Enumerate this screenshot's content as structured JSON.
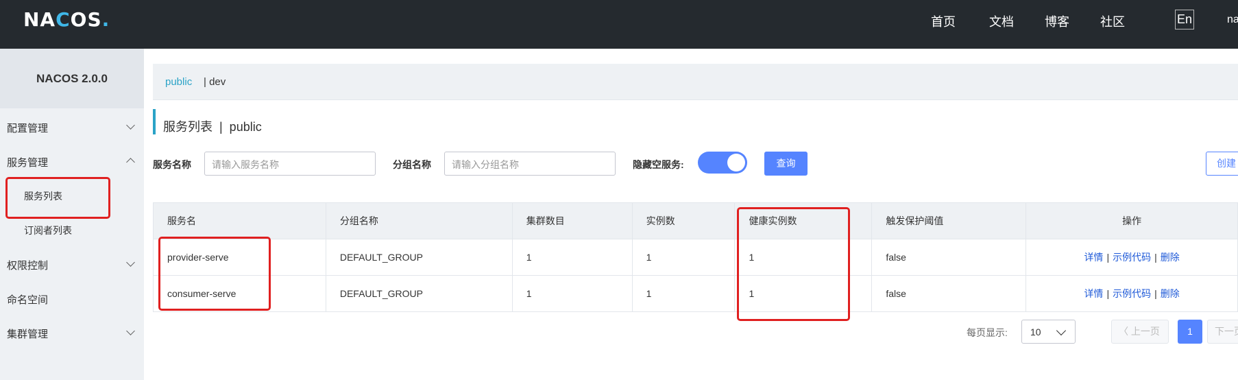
{
  "header": {
    "logo": "NACOS.",
    "nav": [
      "首页",
      "文档",
      "博客",
      "社区"
    ],
    "lang": "En",
    "user": "na"
  },
  "sidebar": {
    "version": "NACOS 2.0.0",
    "items": [
      {
        "label": "配置管理"
      },
      {
        "label": "服务管理"
      },
      {
        "label": "服务列表"
      },
      {
        "label": "订阅者列表"
      },
      {
        "label": "权限控制"
      },
      {
        "label": "命名空间"
      },
      {
        "label": "集群管理"
      }
    ]
  },
  "namespaces": {
    "active": "public",
    "other": "| dev"
  },
  "page": {
    "title": "服务列表  |  public"
  },
  "filters": {
    "service_label": "服务名称",
    "service_placeholder": "请输入服务名称",
    "group_label": "分组名称",
    "group_placeholder": "请输入分组名称",
    "hide_empty_label": "隐藏空服务:",
    "query_button": "查询",
    "create_button": "创建"
  },
  "table": {
    "headers": [
      "服务名",
      "分组名称",
      "集群数目",
      "实例数",
      "健康实例数",
      "触发保护阈值",
      "操作"
    ],
    "rows": [
      {
        "name": "provider-serve",
        "group": "DEFAULT_GROUP",
        "clusters": "1",
        "instances": "1",
        "healthy": "1",
        "threshold": "false"
      },
      {
        "name": "consumer-serve",
        "group": "DEFAULT_GROUP",
        "clusters": "1",
        "instances": "1",
        "healthy": "1",
        "threshold": "false"
      }
    ],
    "actions": {
      "detail": "详情",
      "sample": "示例代码",
      "delete": "删除"
    }
  },
  "pagination": {
    "per_page_label": "每页显示:",
    "per_page_value": "10",
    "prev": "〈 上一页",
    "current": "1",
    "next": "下一页"
  }
}
